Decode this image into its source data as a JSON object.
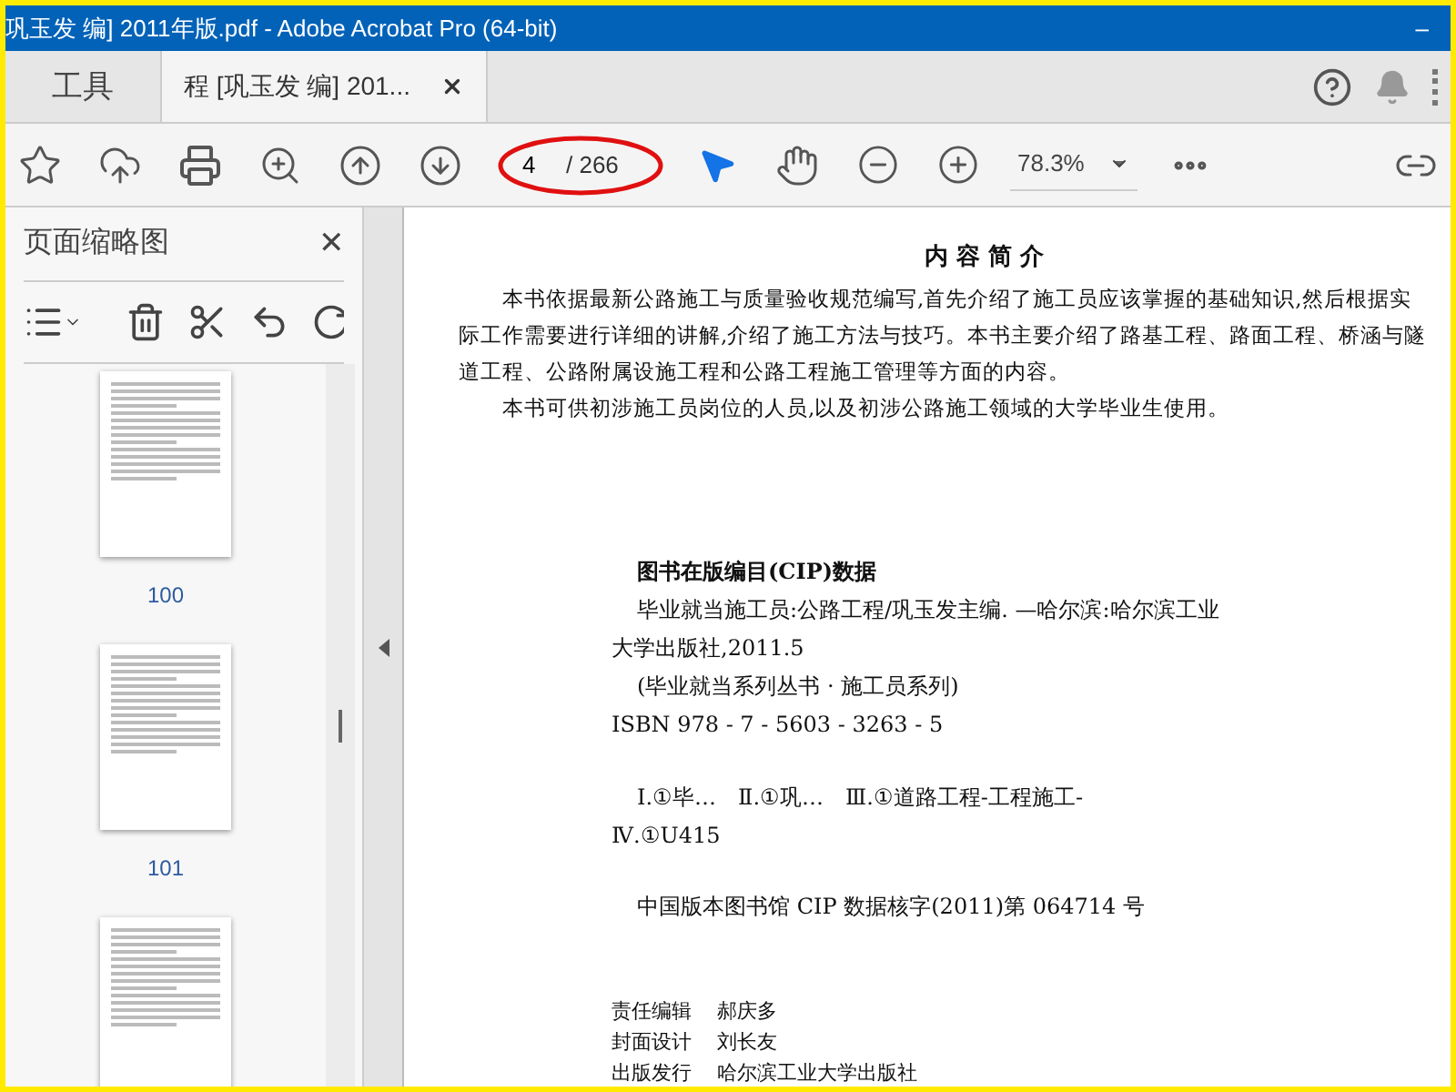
{
  "window": {
    "title": "巩玉发 编] 2011年版.pdf - Adobe Acrobat Pro (64-bit)",
    "minimize": "–"
  },
  "tabs": [
    {
      "label": "工具",
      "selected": false,
      "closable": false
    },
    {
      "label": "程 [巩玉发 编] 201...",
      "selected": true,
      "closable": true
    }
  ],
  "toolbar": {
    "page_number": "4",
    "page_total": "/ 266",
    "zoom": "78.3%",
    "annotated": true
  },
  "thumbnails_panel": {
    "title": "页面缩略图",
    "close": "✕",
    "pages": [
      {
        "label": "100"
      },
      {
        "label": "101"
      }
    ],
    "more_below": true
  },
  "document": {
    "heading": "内 容 简 介",
    "summary_lines": [
      {
        "text": "本书依据最新公路施工与质量验收规范编写,首先介绍了施工员应该掌握的基础知识,然后根据实",
        "indent": true
      },
      {
        "text": "际工作需要进行详细的讲解,介绍了施工方法与技巧。本书主要介绍了路基工程、路面工程、桥涵与隧",
        "indent": false
      },
      {
        "text": "道工程、公路附属设施工程和公路工程施工管理等方面的内容。",
        "indent": false
      },
      {
        "text": "本书可供初涉施工员岗位的人员,以及初涉公路施工领域的大学毕业生使用。",
        "indent": true
      }
    ],
    "cip_title": "图书在版编目(CIP)数据",
    "cip_lines": [
      {
        "text": "毕业就当施工员:公路工程/巩玉发主编. —哈尔滨:哈尔滨工业",
        "indent": true
      },
      {
        "text": "大学出版社,2011.5",
        "indent": false
      },
      {
        "text": "(毕业就当系列丛书 · 施工员系列)",
        "indent": true
      },
      {
        "text": "ISBN 978 - 7 - 5603 - 3263 - 5",
        "indent": false
      }
    ],
    "classification_lines": [
      {
        "text": "Ⅰ.①毕…　Ⅱ.①巩…　Ⅲ.①道路工程-工程施工-",
        "indent": true
      },
      {
        "text": "Ⅳ.①U415",
        "indent": false
      }
    ],
    "cip_number": "中国版本图书馆 CIP 数据核字(2011)第 064714 号",
    "credits": [
      {
        "role": "责任编辑",
        "name": "郝庆多"
      },
      {
        "role": "封面设计",
        "name": "刘长友"
      },
      {
        "role": "出版发行",
        "name": "哈尔滨工业大学出版社"
      }
    ]
  }
}
